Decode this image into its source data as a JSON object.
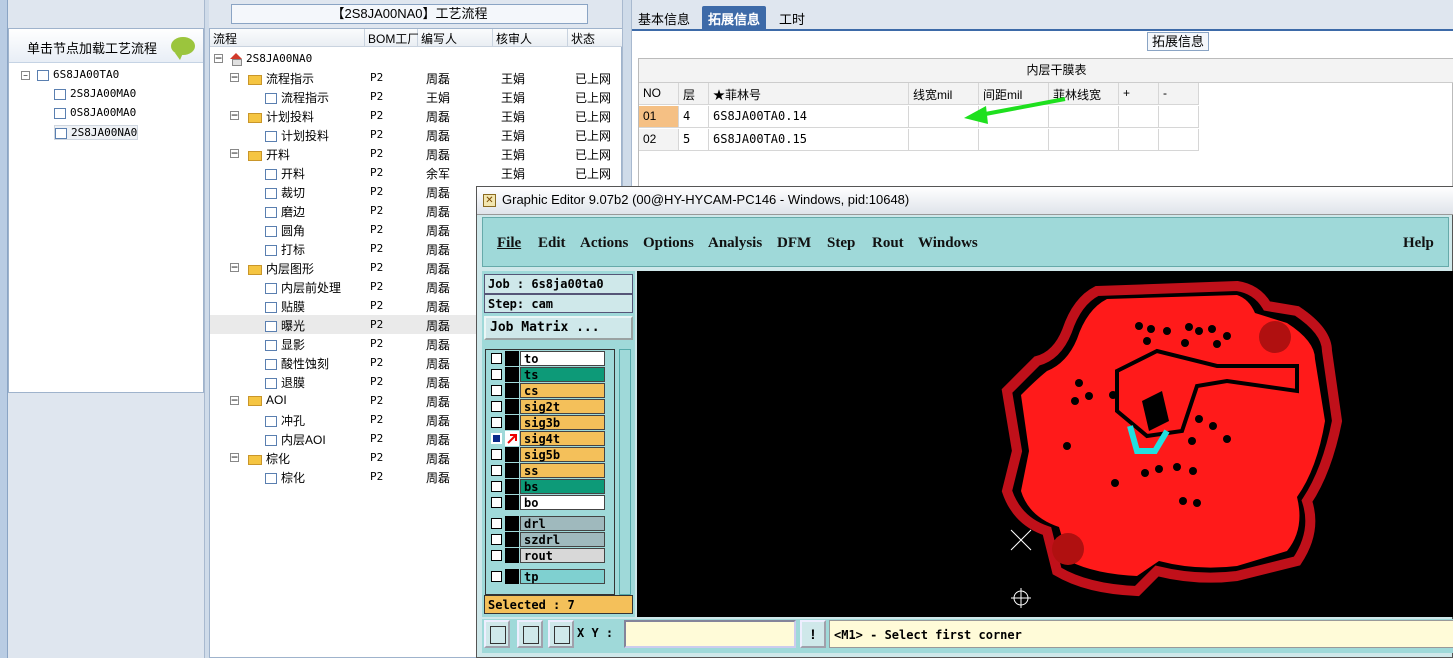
{
  "left": {
    "header": "单击节点加载工艺流程",
    "tree": [
      {
        "label": "6S8JA00TA0",
        "level": 0
      },
      {
        "label": "2S8JA00MA0",
        "level": 1
      },
      {
        "label": "0S8JA00MA0",
        "level": 1
      },
      {
        "label": "2S8JA00NA0",
        "level": 1,
        "selected": true
      }
    ]
  },
  "middle": {
    "title": "【2S8JA00NA0】工艺流程",
    "columns": [
      "流程",
      "BOM工厂",
      "编写人",
      "核审人",
      "状态"
    ],
    "root": "2S8JA00NA0",
    "rows": [
      {
        "name": "流程指示",
        "kind": "folder",
        "bom": "P2",
        "writer": "周磊",
        "reviewer": "王娟",
        "status": "已上网"
      },
      {
        "name": "流程指示",
        "kind": "doc",
        "bom": "P2",
        "writer": "王娟",
        "reviewer": "王娟",
        "status": "已上网"
      },
      {
        "name": "计划投料",
        "kind": "folder",
        "bom": "P2",
        "writer": "周磊",
        "reviewer": "王娟",
        "status": "已上网"
      },
      {
        "name": "计划投料",
        "kind": "doc",
        "bom": "P2",
        "writer": "周磊",
        "reviewer": "王娟",
        "status": "已上网"
      },
      {
        "name": "开料",
        "kind": "folder",
        "bom": "P2",
        "writer": "周磊",
        "reviewer": "王娟",
        "status": "已上网"
      },
      {
        "name": "开料",
        "kind": "doc",
        "bom": "P2",
        "writer": "余军",
        "reviewer": "王娟",
        "status": "已上网"
      },
      {
        "name": "裁切",
        "kind": "doc",
        "bom": "P2",
        "writer": "周磊",
        "reviewer": "",
        "status": ""
      },
      {
        "name": "磨边",
        "kind": "doc",
        "bom": "P2",
        "writer": "周磊",
        "reviewer": "",
        "status": ""
      },
      {
        "name": "圆角",
        "kind": "doc",
        "bom": "P2",
        "writer": "周磊",
        "reviewer": "",
        "status": ""
      },
      {
        "name": "打标",
        "kind": "doc",
        "bom": "P2",
        "writer": "周磊",
        "reviewer": "",
        "status": ""
      },
      {
        "name": "内层图形",
        "kind": "folder",
        "bom": "P2",
        "writer": "周磊",
        "reviewer": "",
        "status": ""
      },
      {
        "name": "内层前处理",
        "kind": "doc",
        "bom": "P2",
        "writer": "周磊",
        "reviewer": "",
        "status": ""
      },
      {
        "name": "贴膜",
        "kind": "doc",
        "bom": "P2",
        "writer": "周磊",
        "reviewer": "",
        "status": ""
      },
      {
        "name": "曝光",
        "kind": "doc",
        "bom": "P2",
        "writer": "周磊",
        "reviewer": "",
        "status": "",
        "selected": true
      },
      {
        "name": "显影",
        "kind": "doc",
        "bom": "P2",
        "writer": "周磊",
        "reviewer": "",
        "status": ""
      },
      {
        "name": "酸性蚀刻",
        "kind": "doc",
        "bom": "P2",
        "writer": "周磊",
        "reviewer": "",
        "status": ""
      },
      {
        "name": "退膜",
        "kind": "doc",
        "bom": "P2",
        "writer": "周磊",
        "reviewer": "",
        "status": ""
      },
      {
        "name": "AOI",
        "kind": "folder",
        "bom": "P2",
        "writer": "周磊",
        "reviewer": "",
        "status": ""
      },
      {
        "name": "冲孔",
        "kind": "doc",
        "bom": "P2",
        "writer": "周磊",
        "reviewer": "",
        "status": ""
      },
      {
        "name": "内层AOI",
        "kind": "doc",
        "bom": "P2",
        "writer": "周磊",
        "reviewer": "",
        "status": ""
      },
      {
        "name": "棕化",
        "kind": "folder",
        "bom": "P2",
        "writer": "周磊",
        "reviewer": "",
        "status": ""
      },
      {
        "name": "棕化",
        "kind": "doc",
        "bom": "P2",
        "writer": "周磊",
        "reviewer": "",
        "status": ""
      }
    ]
  },
  "right": {
    "tabs": [
      "基本信息",
      "拓展信息",
      "工时"
    ],
    "active_tab": "拓展信息",
    "section_label": "拓展信息",
    "grid_caption": "内层干膜表",
    "grid_headers": [
      "NO",
      "层",
      "★菲林号",
      "线宽mil",
      "间距mil",
      "菲林线宽",
      "+",
      "-"
    ],
    "grid_rows": [
      [
        "01",
        "4",
        "6S8JA00TA0.14",
        "",
        "",
        "",
        "",
        ""
      ],
      [
        "02",
        "5",
        "6S8JA00TA0.15",
        "",
        "",
        "",
        "",
        ""
      ]
    ]
  },
  "editor": {
    "title": "Graphic Editor 9.07b2 (00@HY-HYCAM-PC146 - Windows, pid:10648)",
    "menu": [
      "File",
      "Edit",
      "Actions",
      "Options",
      "Analysis",
      "DFM",
      "Step",
      "Rout",
      "Windows"
    ],
    "help": "Help",
    "job": "Job : 6s8ja00ta0",
    "step": "Step: cam",
    "job_matrix": "Job Matrix ...",
    "layers": [
      {
        "name": "to",
        "color": "#ffffff"
      },
      {
        "name": "ts",
        "color": "#0d9a78"
      },
      {
        "name": "cs",
        "color": "#f4c05a"
      },
      {
        "name": "sig2t",
        "color": "#f4c05a"
      },
      {
        "name": "sig3b",
        "color": "#f4c05a"
      },
      {
        "name": "sig4t",
        "color": "#f4c05a",
        "active": true
      },
      {
        "name": "sig5b",
        "color": "#f4c05a"
      },
      {
        "name": "ss",
        "color": "#f4c05a"
      },
      {
        "name": "bs",
        "color": "#0d9a78"
      },
      {
        "name": "bo",
        "color": "#ffffff"
      },
      {
        "name": "drl",
        "color": "#9fb9bd"
      },
      {
        "name": "szdrl",
        "color": "#9fb9bd"
      },
      {
        "name": "rout",
        "color": "#d8d8d8"
      },
      {
        "name": "tp",
        "color": "#7fd0d0"
      }
    ],
    "selected": "Selected : 7",
    "xy_label": "X Y :",
    "exclaim": "!",
    "prompt": "<M1> - Select first corner"
  }
}
